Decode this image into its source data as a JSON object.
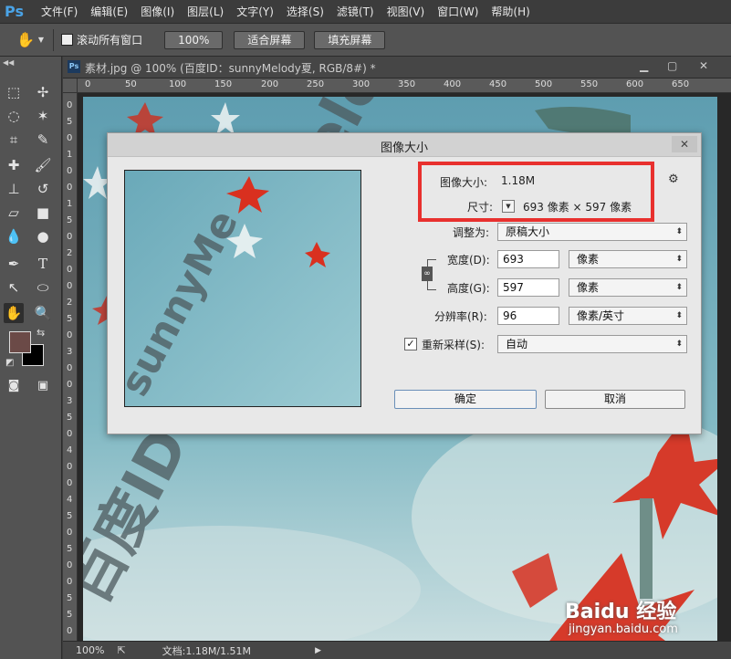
{
  "app": {
    "logo": "Ps"
  },
  "menu": [
    "文件(F)",
    "编辑(E)",
    "图像(I)",
    "图层(L)",
    "文字(Y)",
    "选择(S)",
    "滤镜(T)",
    "视图(V)",
    "窗口(W)",
    "帮助(H)"
  ],
  "options": {
    "scroll_all_label": "滚动所有窗口",
    "zoom_100": "100%",
    "fit_screen": "适合屏幕",
    "fill_screen": "填充屏幕"
  },
  "document": {
    "tab_title": "素材.jpg @ 100% (百度ID：sunnyMelody夏, RGB/8#) *",
    "ruler_top": [
      "0",
      "50",
      "100",
      "150",
      "200",
      "250",
      "300",
      "350",
      "400",
      "450",
      "500",
      "550",
      "600",
      "650"
    ],
    "ruler_left": [
      "0",
      "5",
      "0",
      "1",
      "0",
      "0",
      "1",
      "5",
      "0",
      "2",
      "0",
      "0",
      "2",
      "5",
      "0",
      "3",
      "0",
      "0",
      "3",
      "5",
      "0",
      "4",
      "0",
      "0",
      "4",
      "5",
      "0",
      "5",
      "0",
      "0",
      "5",
      "5",
      "0"
    ],
    "watermark": "百度ID：sunnyMelody夏",
    "zoom": "100%",
    "doc_info": "文档:1.18M/1.51M",
    "baidu_brand": "Baidu 经验",
    "baidu_url": "jingyan.baidu.com"
  },
  "dialog": {
    "title": "图像大小",
    "close": "✕",
    "image_size_label": "图像大小:",
    "image_size_value": "1.18M",
    "dimensions_label": "尺寸:",
    "dimensions_value": "693 像素 × 597 像素",
    "fit_to_label": "调整为:",
    "fit_to_value": "原稿大小",
    "width_label": "宽度(D):",
    "width_value": "693",
    "width_unit": "像素",
    "height_label": "高度(G):",
    "height_value": "597",
    "height_unit": "像素",
    "resolution_label": "分辨率(R):",
    "resolution_value": "96",
    "resolution_unit": "像素/英寸",
    "resample_label": "重新采样(S):",
    "resample_value": "自动",
    "resample_checked": true,
    "ok": "确定",
    "cancel": "取消",
    "preview_watermark": "sunnyMe"
  },
  "colors": {
    "highlight": "#e8302e",
    "foreground": "#6b4a47",
    "background": "#000000"
  }
}
